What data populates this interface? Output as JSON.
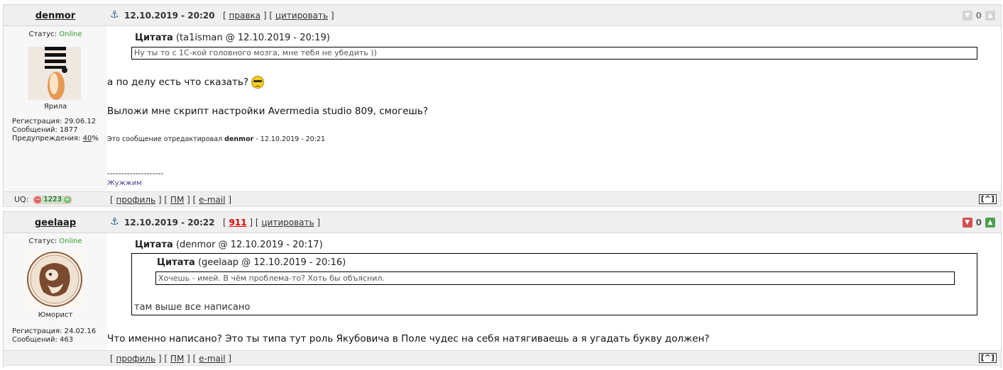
{
  "posts": [
    {
      "author": "denmor",
      "datetime": "12.10.2019 - 20:20",
      "links": {
        "edit": "правка",
        "quote": "цитировать"
      },
      "votes": {
        "count": "0"
      },
      "status_label": "Статус:",
      "status_value": "Online",
      "rank": "Ярила",
      "reg_label": "Регистрация: 29.06.12",
      "msgs_label": "Сообщений: 1877",
      "warn_label": "Предупреждения:",
      "warn_value": "40",
      "warn_suffix": "%",
      "quote": {
        "head": "Цитата",
        "meta": "(ta1isman @ 12.10.2019 - 20:19)",
        "text": "Ну ты то с 1С-кой головного мозга, мне тебя не убедить ))"
      },
      "line1": "а по делу есть что сказать?",
      "line2": "Выложи мне скрипт настройки Avermedia studio 809, смогешь?",
      "edited_prefix": "Это сообщение отредактировал",
      "edited_by": "denmor",
      "edited_suffix": "- 12.10.2019 - 20:21",
      "sig_line": "--------------------",
      "sig_text": "Жужжим",
      "uq_label": "UQ:",
      "uq_minus": "−",
      "uq_value": "1223",
      "uq_plus": "+",
      "footer": {
        "profile": "профиль",
        "pm": "ПМ",
        "email": "e-mail",
        "top": "[^]"
      }
    },
    {
      "author": "geelaap",
      "datetime": "12.10.2019 - 20:22",
      "links": {
        "num": "911",
        "quote": "цитировать"
      },
      "votes": {
        "count": "0"
      },
      "status_label": "Статус:",
      "status_value": "Online",
      "rank": "Юморист",
      "reg_label": "Регистрация: 24.02.16",
      "msgs_label": "Сообщений: 463",
      "quote": {
        "head": "Цитата",
        "meta": "(denmor @ 12.10.2019 - 20:17)",
        "inner_head": "Цитата",
        "inner_meta": "(geelaap @ 12.10.2019 - 20:16)",
        "inner_text": "Хочешь - имей. В чём проблема-то? Хоть бы объяснил.",
        "text": "там выше все написано"
      },
      "line1": "Что именно написано? Это ты типа тут роль Якубовича в Поле чудес на себя натягиваешь а я угадать букву должен?",
      "footer": {
        "profile": "профиль",
        "pm": "ПМ",
        "email": "e-mail",
        "top": "[^]"
      }
    }
  ]
}
